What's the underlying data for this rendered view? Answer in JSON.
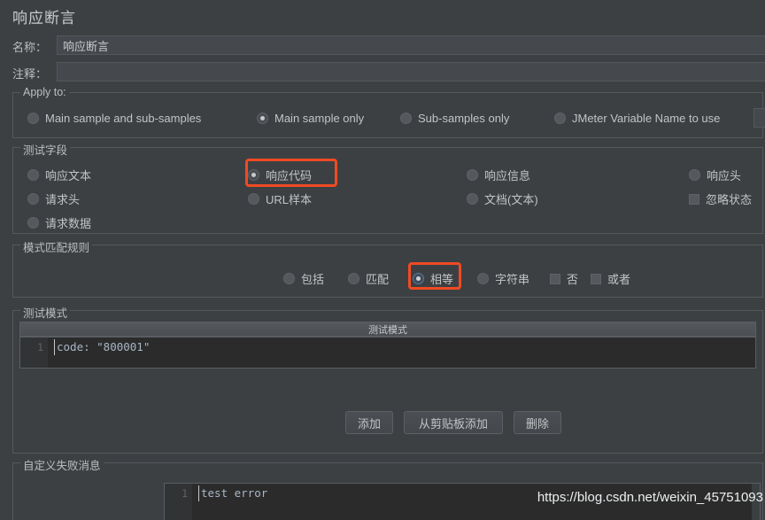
{
  "window": {
    "title": "响应断言"
  },
  "fields": {
    "name_label": "名称：",
    "name_value": "响应断言",
    "comment_label": "注释：",
    "comment_value": ""
  },
  "apply_to": {
    "title": "Apply to:",
    "options": [
      {
        "label": "Main sample and sub-samples",
        "selected": false
      },
      {
        "label": "Main sample only",
        "selected": true
      },
      {
        "label": "Sub-samples only",
        "selected": false
      },
      {
        "label": "JMeter Variable Name to use",
        "selected": false
      }
    ],
    "variable_value": ""
  },
  "test_field": {
    "title": "测试字段",
    "options": [
      {
        "label": "响应文本",
        "type": "radio",
        "selected": false
      },
      {
        "label": "请求头",
        "type": "radio",
        "selected": false
      },
      {
        "label": "请求数据",
        "type": "radio",
        "selected": false
      },
      {
        "label": "响应代码",
        "type": "radio",
        "selected": true,
        "highlighted": true
      },
      {
        "label": "URL样本",
        "type": "radio",
        "selected": false
      },
      {
        "label": "响应信息",
        "type": "radio",
        "selected": false
      },
      {
        "label": "文档(文本)",
        "type": "radio",
        "selected": false
      },
      {
        "label": "响应头",
        "type": "radio",
        "selected": false
      },
      {
        "label": "忽略状态",
        "type": "checkbox",
        "selected": false
      }
    ]
  },
  "pattern_rule": {
    "title": "模式匹配规则",
    "options": [
      {
        "label": "包括",
        "type": "radio",
        "selected": false
      },
      {
        "label": "匹配",
        "type": "radio",
        "selected": false
      },
      {
        "label": "相等",
        "type": "radio",
        "selected": true,
        "highlighted": true
      },
      {
        "label": "字符串",
        "type": "radio",
        "selected": false
      },
      {
        "label": "否",
        "type": "checkbox",
        "selected": false
      },
      {
        "label": "或者",
        "type": "checkbox",
        "selected": false
      }
    ]
  },
  "test_pattern": {
    "title": "测试模式",
    "column_header": "测试模式",
    "rows": [
      {
        "line_number": "1",
        "value": "code: \"800001\""
      }
    ],
    "buttons": {
      "add": "添加",
      "add_from_clipboard": "从剪贴板添加",
      "delete": "删除"
    }
  },
  "failure_message": {
    "title": "自定义失败消息",
    "rows": [
      {
        "line_number": "1",
        "value": "test error"
      }
    ]
  },
  "watermark": {
    "text": "https://blog.csdn.net/weixin_45751093"
  },
  "colors": {
    "background": "#3c4043",
    "highlight": "#f04a23",
    "editor_background": "#2b2b2b",
    "code_text": "#a9b7c6"
  }
}
